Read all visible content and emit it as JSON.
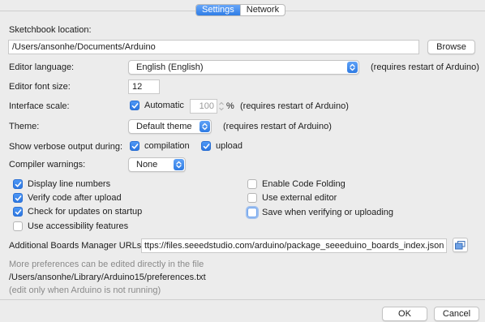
{
  "tabs": [
    {
      "label": "Settings",
      "active": true
    },
    {
      "label": "Network",
      "active": false
    }
  ],
  "sketchbook": {
    "label": "Sketchbook location:",
    "value": "/Users/ansonhe/Documents/Arduino",
    "browse_label": "Browse"
  },
  "editor_language": {
    "label": "Editor language:",
    "value": "English (English)",
    "note": "(requires restart of Arduino)"
  },
  "font_size": {
    "label": "Editor font size:",
    "value": "12"
  },
  "interface_scale": {
    "label": "Interface scale:",
    "automatic_label": "Automatic",
    "automatic_checked": true,
    "value": "100",
    "unit": "%",
    "note": "(requires restart of Arduino)"
  },
  "theme": {
    "label": "Theme:",
    "value": "Default theme",
    "note": "(requires restart of Arduino)"
  },
  "verbose": {
    "label": "Show verbose output during:",
    "compilation_label": "compilation",
    "compilation_checked": true,
    "upload_label": "upload",
    "upload_checked": true
  },
  "warnings": {
    "label": "Compiler warnings:",
    "value": "None"
  },
  "options_left": [
    {
      "label": "Display line numbers",
      "checked": true
    },
    {
      "label": "Verify code after upload",
      "checked": true
    },
    {
      "label": "Check for updates on startup",
      "checked": true
    },
    {
      "label": "Use accessibility features",
      "checked": false
    }
  ],
  "options_right": [
    {
      "label": "Enable Code Folding",
      "checked": false
    },
    {
      "label": "Use external editor",
      "checked": false
    },
    {
      "label": "Save when verifying or uploading",
      "checked": false
    }
  ],
  "boards_urls": {
    "label": "Additional Boards Manager URLs:",
    "value": "ttps://files.seeedstudio.com/arduino/package_seeeduino_boards_index.json"
  },
  "prefs_info": {
    "line1": "More preferences can be edited directly in the file",
    "path": "/Users/ansonhe/Library/Arduino15/preferences.txt",
    "line3": "(edit only when Arduino is not running)"
  },
  "footer": {
    "ok_label": "OK",
    "cancel_label": "Cancel"
  },
  "colors": {
    "accent": "#2f7de6",
    "background": "#ececec"
  },
  "icons": {
    "select_arrow": "updown-chevron-icon",
    "check": "checkmark-icon",
    "url_editor": "window-stack-icon"
  }
}
